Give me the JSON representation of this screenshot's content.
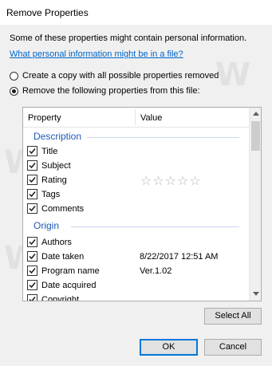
{
  "window": {
    "title": "Remove Properties"
  },
  "info_text": "Some of these properties might contain personal information.",
  "link_text": "What personal information might be in a file?",
  "options": {
    "copy_label": "Create a copy with all possible properties removed",
    "remove_label": "Remove the following properties from this file:",
    "selected": "remove"
  },
  "list": {
    "columns": {
      "property": "Property",
      "value": "Value"
    },
    "groups": [
      {
        "title": "Description",
        "items": [
          {
            "label": "Title",
            "value": "",
            "checked": true
          },
          {
            "label": "Subject",
            "value": "",
            "checked": true
          },
          {
            "label": "Rating",
            "value": "☆☆☆☆☆",
            "rating": 0,
            "max_rating": 5,
            "checked": true
          },
          {
            "label": "Tags",
            "value": "",
            "checked": true
          },
          {
            "label": "Comments",
            "value": "",
            "checked": true
          }
        ]
      },
      {
        "title": "Origin",
        "items": [
          {
            "label": "Authors",
            "value": "",
            "checked": true
          },
          {
            "label": "Date taken",
            "value": "8/22/2017 12:51 AM",
            "checked": true
          },
          {
            "label": "Program name",
            "value": "Ver.1.02",
            "checked": true
          },
          {
            "label": "Date acquired",
            "value": "",
            "checked": true
          },
          {
            "label": "Copyright",
            "value": "",
            "checked": true
          }
        ]
      }
    ]
  },
  "buttons": {
    "select_all": "Select All",
    "ok": "OK",
    "cancel": "Cancel"
  },
  "watermark": {
    "text": "http://winaero.com"
  },
  "colors": {
    "link": "#0066cc",
    "group_title": "#1e5bb8",
    "default_button_border": "#0078d7"
  }
}
